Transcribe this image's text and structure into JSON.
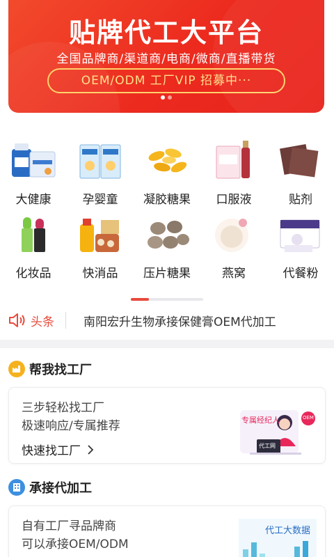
{
  "banner": {
    "title": "贴牌代工大平台",
    "subtitle": "全国品牌商/渠道商/电商/微商/直播带货",
    "pill": "OEM/ODM 工厂VIP 招募中···"
  },
  "categories": [
    {
      "label": "大健康",
      "icon": "health-product-icon"
    },
    {
      "label": "孕婴童",
      "icon": "baby-product-icon"
    },
    {
      "label": "凝胶糖果",
      "icon": "softgel-candy-icon"
    },
    {
      "label": "口服液",
      "icon": "oral-liquid-icon"
    },
    {
      "label": "贴剂",
      "icon": "patch-icon"
    },
    {
      "label": "化妆品",
      "icon": "cosmetics-icon"
    },
    {
      "label": "快消品",
      "icon": "fmcg-icon"
    },
    {
      "label": "压片糖果",
      "icon": "tablet-candy-icon"
    },
    {
      "label": "燕窝",
      "icon": "birds-nest-icon"
    },
    {
      "label": "代餐粉",
      "icon": "meal-powder-icon"
    }
  ],
  "news": {
    "tag": "头条",
    "text": "南阳宏升生物承接保健膏OEM代加工"
  },
  "find_factory": {
    "title": "帮我找工厂",
    "line1": "三步轻松找工厂",
    "line2": "极速响应/专属推荐",
    "link": "快速找工厂",
    "illus_label": "专属经纪人",
    "illus_badge": "OEM",
    "illus_screen": "代工网"
  },
  "contract": {
    "title": "承接代加工",
    "line1": "自有工厂寻品牌商",
    "line2": "可以承接OEM/ODM",
    "illus_label": "代工大数据"
  },
  "colors": {
    "accent": "#e84a3c",
    "banner_red": "#ec2a1e",
    "pill_gold": "#ffd36b"
  }
}
